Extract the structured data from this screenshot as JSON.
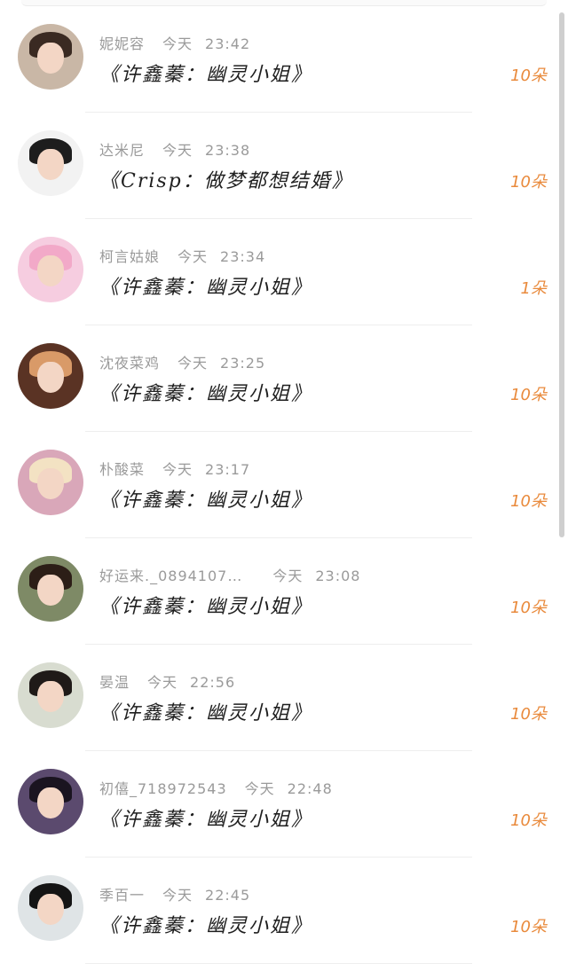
{
  "items": [
    {
      "name": "妮妮容",
      "day": "今天",
      "time": "23:42",
      "song": "《许鑫蓁：幽灵小姐》",
      "count": "10朵",
      "avatar_colors": {
        "bg": "#c9b7a6",
        "hair": "#3a2a22"
      }
    },
    {
      "name": "达米尼",
      "day": "今天",
      "time": "23:38",
      "song": "《Crisp：做梦都想结婚》",
      "count": "10朵",
      "avatar_colors": {
        "bg": "#f2f2f2",
        "hair": "#1d1d1d"
      }
    },
    {
      "name": "柯言姑娘",
      "day": "今天",
      "time": "23:34",
      "song": "《许鑫蓁：幽灵小姐》",
      "count": "1朵",
      "avatar_colors": {
        "bg": "#f6cde0",
        "hair": "#f2a9c8"
      }
    },
    {
      "name": "沈夜菜鸡",
      "day": "今天",
      "time": "23:25",
      "song": "《许鑫蓁：幽灵小姐》",
      "count": "10朵",
      "avatar_colors": {
        "bg": "#5a3324",
        "hair": "#d99a68"
      }
    },
    {
      "name": "朴酸菜",
      "day": "今天",
      "time": "23:17",
      "song": "《许鑫蓁：幽灵小姐》",
      "count": "10朵",
      "avatar_colors": {
        "bg": "#d9a7b9",
        "hair": "#f3e2c3"
      }
    },
    {
      "name": "好运来._0894107…",
      "day": "今天",
      "time": "23:08",
      "song": "《许鑫蓁：幽灵小姐》",
      "count": "10朵",
      "avatar_colors": {
        "bg": "#7e8a66",
        "hair": "#2c1e17"
      }
    },
    {
      "name": "晏温",
      "day": "今天",
      "time": "22:56",
      "song": "《许鑫蓁：幽灵小姐》",
      "count": "10朵",
      "avatar_colors": {
        "bg": "#d8dcd0",
        "hair": "#1f1a18"
      }
    },
    {
      "name": "初僖_718972543",
      "day": "今天",
      "time": "22:48",
      "song": "《许鑫蓁：幽灵小姐》",
      "count": "10朵",
      "avatar_colors": {
        "bg": "#5b4a6e",
        "hair": "#1a1420"
      }
    },
    {
      "name": "季百一",
      "day": "今天",
      "time": "22:45",
      "song": "《许鑫蓁：幽灵小姐》",
      "count": "10朵",
      "avatar_colors": {
        "bg": "#dfe4e6",
        "hair": "#141414"
      }
    }
  ]
}
